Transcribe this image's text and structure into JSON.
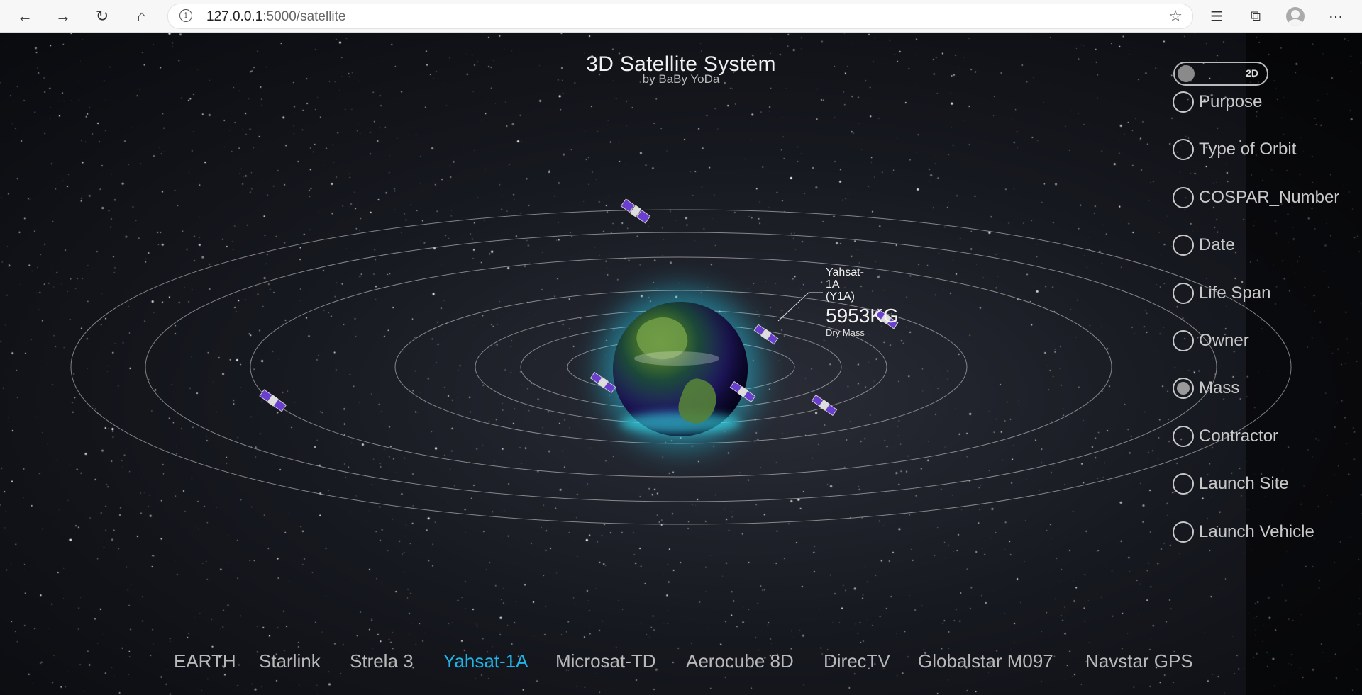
{
  "browser": {
    "url_host": "127.0.0.1",
    "url_path": ":5000/satellite",
    "icons": [
      "back-icon",
      "forward-icon",
      "reload-icon",
      "home-icon",
      "info-icon",
      "star-icon",
      "favorites-icon",
      "collections-icon",
      "profile-icon",
      "more-icon"
    ]
  },
  "header": {
    "title": "3D Satellite System",
    "subtitle": "by BaBy YoDa"
  },
  "toggle": {
    "label": "2D"
  },
  "options": [
    {
      "label": "Purpose",
      "checked": false
    },
    {
      "label": "Type of Orbit",
      "checked": false
    },
    {
      "label": "COSPAR_Number",
      "checked": false
    },
    {
      "label": "Date",
      "checked": false
    },
    {
      "label": "Life Span",
      "checked": false
    },
    {
      "label": "Owner",
      "checked": false
    },
    {
      "label": "Mass",
      "checked": true
    },
    {
      "label": "Contractor",
      "checked": false
    },
    {
      "label": "Launch Site",
      "checked": false
    },
    {
      "label": "Launch Vehicle",
      "checked": false
    }
  ],
  "satellite_label": {
    "name_line1": "Yahsat-",
    "name_line2": "1A",
    "name_line3": "(Y1A)",
    "value": "5953KG",
    "caption": "Dry Mass"
  },
  "menu": {
    "items": [
      "EARTH",
      "Starlink",
      "Strela 3",
      "Yahsat-1A",
      "Microsat-TD",
      "Aerocube 8D",
      "DirecTV",
      "Globalstar M097",
      "Navstar GPS"
    ],
    "active": "Yahsat-1A"
  },
  "colors": {
    "accent": "#1fb4e8",
    "earth_glow": "#28dcff",
    "satellite_panel": "#6a3fd0"
  }
}
